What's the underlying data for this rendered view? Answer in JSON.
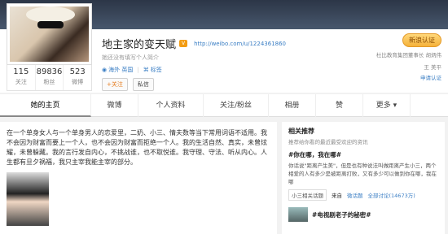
{
  "profile": {
    "username": "地主家的变天赋",
    "vip_label": "V",
    "url": "http://weibo.com/u/1224361860",
    "intro": "她还没有填写个人简介",
    "tags": [
      "海外 英国",
      "标签"
    ],
    "actions": {
      "follow": "+关注",
      "message": "私信"
    }
  },
  "stats": [
    {
      "num": "115",
      "label": "关注"
    },
    {
      "num": "89836",
      "label": "粉丝"
    },
    {
      "num": "523",
      "label": "微博"
    }
  ],
  "right": {
    "follow_me": "新浪认证",
    "verify_line1": "杜比教育集团董事长 胡炳伟",
    "verify_line2": "王 美平",
    "apply": "申请认证"
  },
  "tabs": [
    "她的主页",
    "微博",
    "个人资料",
    "关注/粉丝",
    "相册",
    "赞",
    "更多"
  ],
  "main": {
    "text": "在一个单身女人与一个单身男人的恋爱里，二奶、小三、情夫数等当下常用词语不适用。我不会因为财富而要上一个人，也不会因为财富而拒绝一个人。我的生活自然、真实，未曾炫耀，未曾躲藏。我的言行发自内心，不挑战谁，也不取悦谁。我守理、守法、听从内心。人生都有旦夕祸福，我只主宰我能主宰的部分。"
  },
  "side": {
    "title": "相关推荐",
    "subtitle": "推荐给你看的最近最受欢迎的资讯",
    "post1_title": "#你在哪，我在哪#",
    "post1_body": "你话说\"距离产生美\"，但是也有种说法叫做距离产生小三，两个相爱的人有多少是被距离打败，又有多少可以做到你在哪，我在哪",
    "post1_chip": "小三相关话题",
    "post1_from": "来自",
    "post1_source": "微话题",
    "post1_count": "全部讨论(14673万)",
    "post2_title": "#电视剧老子的秘密#"
  }
}
